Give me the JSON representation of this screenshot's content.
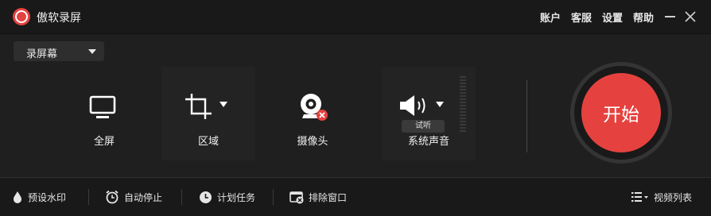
{
  "app": {
    "title": "傲软录屏"
  },
  "top_menu": {
    "account": "账户",
    "service": "客服",
    "settings": "设置",
    "help": "帮助"
  },
  "mode_select": {
    "value": "录屏幕"
  },
  "tools": {
    "full": {
      "label": "全屏"
    },
    "region": {
      "label": "区域"
    },
    "camera": {
      "label": "摄像头"
    },
    "audio": {
      "label": "系统声音",
      "test_label": "试听"
    }
  },
  "start_button": {
    "label": "开始"
  },
  "bottom": {
    "watermark": "预设水印",
    "auto_stop": "自动停止",
    "schedule": "计划任务",
    "exclude_window": "排除窗口",
    "video_list": "视频列表"
  },
  "colors": {
    "accent": "#e5423f",
    "background": "#1f1f1f",
    "bar": "#191919"
  },
  "icons": {
    "logo": "record-logo-icon",
    "full": "monitor-icon",
    "region": "crop-icon",
    "camera": "webcam-icon",
    "audio": "speaker-icon",
    "watermark": "drop-icon",
    "auto_stop": "alarm-clock-icon",
    "schedule": "clock-icon",
    "exclude": "window-exclude-icon",
    "list": "list-icon"
  }
}
